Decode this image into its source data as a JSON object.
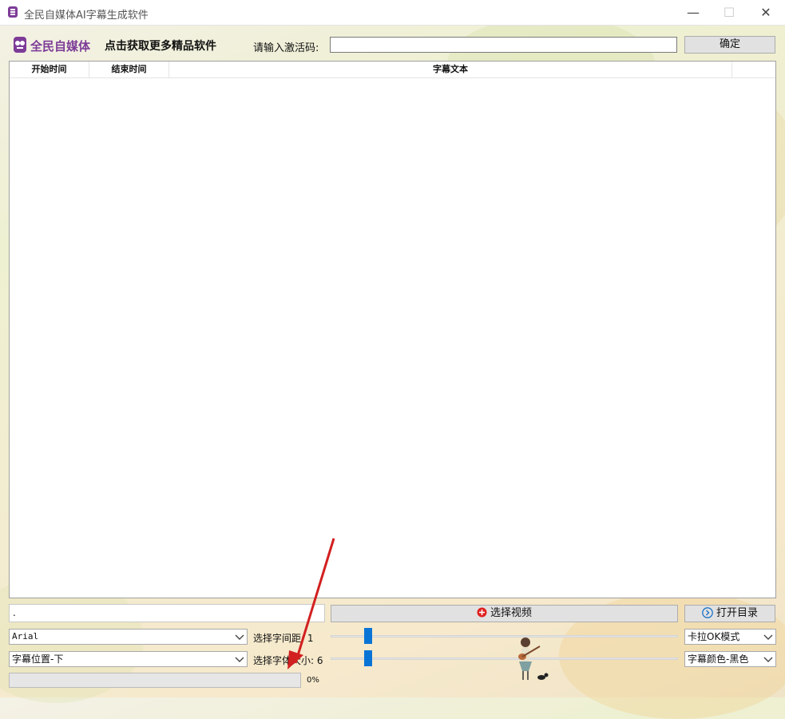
{
  "window": {
    "title": "全民自媒体AI字幕生成软件"
  },
  "brand": {
    "name": "全民自媒体"
  },
  "header": {
    "promo_link": "点击获取更多精品软件",
    "activation_label": "请输入激活码:",
    "activation_value": "",
    "confirm_label": "确定"
  },
  "table": {
    "columns": [
      "开始时间",
      "结束时间",
      "字幕文本"
    ],
    "rows": []
  },
  "controls": {
    "video_path": ".",
    "select_video_label": "选择视频",
    "open_folder_label": "打开目录",
    "font_select": "Arial",
    "position_select": "字幕位置-下",
    "spacing_label": "选择字间距: 1",
    "spacing_value": 1,
    "size_label": "选择字体大小: 6",
    "size_value": 6,
    "mode_select": "卡拉OK模式",
    "color_select": "字幕颜色-黑色",
    "progress_text": "0%",
    "progress_value": 0
  },
  "colors": {
    "accent": "#0a74d6",
    "brand": "#7d3c98",
    "icon_red": "#e02020",
    "icon_blue": "#1a73c8"
  }
}
